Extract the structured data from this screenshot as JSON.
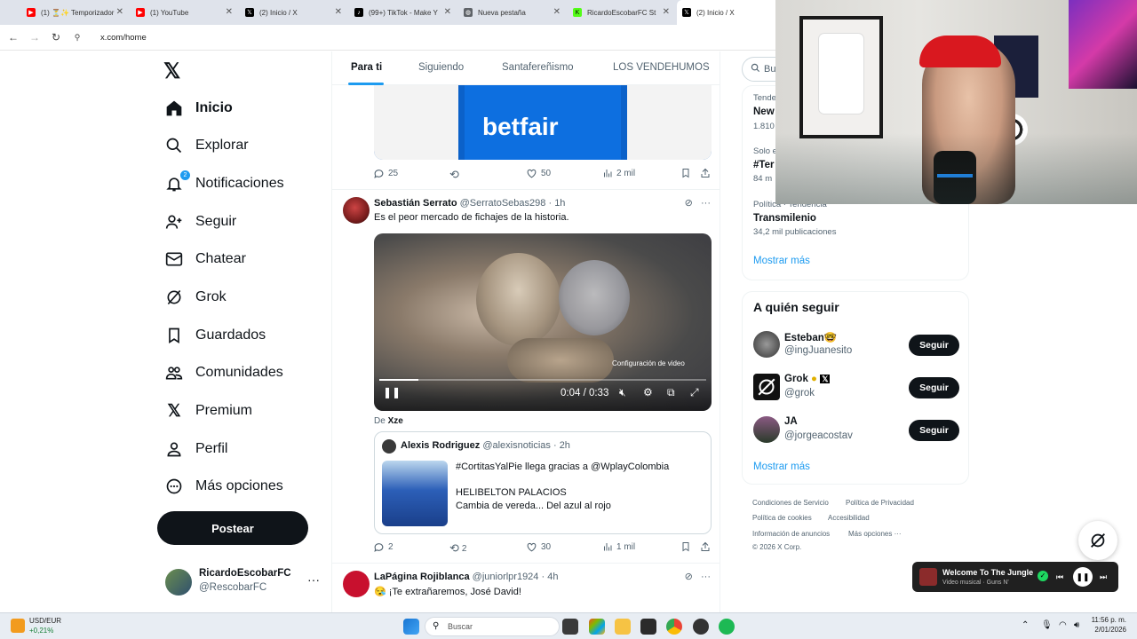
{
  "browser": {
    "tabs": [
      {
        "label": "(1) ⏳✨ Temporizador",
        "color": "#ff0000"
      },
      {
        "label": "(1) YouTube",
        "color": "#ff0000"
      },
      {
        "label": "(2) Inicio / X",
        "color": "#000000"
      },
      {
        "label": "(99+) TikTok - Make Y",
        "color": "#000000"
      },
      {
        "label": "Nueva pestaña",
        "color": "#5f6368"
      },
      {
        "label": "RicardoEscobarFC St",
        "color": "#53fc18"
      },
      {
        "label": "(2) Inicio / X",
        "color": "#000000"
      }
    ],
    "url": "x.com/home"
  },
  "nav": {
    "items": [
      {
        "label": "Inicio",
        "icon": "home-icon"
      },
      {
        "label": "Explorar",
        "icon": "search-icon"
      },
      {
        "label": "Notificaciones",
        "icon": "bell-icon",
        "badge": "2"
      },
      {
        "label": "Seguir",
        "icon": "person-add-icon"
      },
      {
        "label": "Chatear",
        "icon": "mail-icon"
      },
      {
        "label": "Grok",
        "icon": "grok-icon"
      },
      {
        "label": "Guardados",
        "icon": "bookmark-icon"
      },
      {
        "label": "Comunidades",
        "icon": "communities-icon"
      },
      {
        "label": "Premium",
        "icon": "x-logo-icon"
      },
      {
        "label": "Perfil",
        "icon": "person-icon"
      },
      {
        "label": "Más opciones",
        "icon": "more-circle-icon"
      }
    ],
    "post_label": "Postear",
    "profile": {
      "name": "RicardoEscobarFC",
      "handle": "@RescobarFC"
    }
  },
  "feed": {
    "tabs": [
      "Para ti",
      "Siguiendo",
      "Santafereñismo",
      "LOS VENDEHUMOS"
    ],
    "top_post": {
      "brand": "betfair",
      "actions": {
        "replies": "25",
        "reposts": "",
        "likes": "50",
        "views": "2 mil"
      }
    },
    "post1": {
      "name": "Sebastián Serrato",
      "handle": "@SerratoSebas298",
      "time": "· 1h",
      "text": "Es el peor mercado de fichajes de la historia.",
      "video": {
        "settings_tip": "Configuración de video",
        "time": "0:04 / 0:33",
        "progress": 0.12
      },
      "source_prefix": "De",
      "source": "Xze",
      "quote": {
        "name": "Alexis Rodriguez",
        "handle": "@alexisnoticias",
        "time": "· 2h",
        "line1": "#CortitasYalPie llega gracias a @WplayColombia",
        "line2": "HELIBELTON PALACIOS",
        "line3": "Cambia de vereda... Del azul al rojo"
      },
      "actions": {
        "replies": "2",
        "reposts": "2",
        "likes": "30",
        "views": "1 mil"
      }
    },
    "post2": {
      "name": "LaPágina Rojiblanca",
      "handle": "@juniorlpr1924",
      "time": "· 4h",
      "text": "😪 ¡Te extrañaremos, José David!"
    }
  },
  "sidebar": {
    "search_placeholder": "Bu",
    "trends": [
      {
        "meta": "Tende",
        "title": "New",
        "count": "1.810"
      },
      {
        "meta": "Solo e",
        "title": "#Ter",
        "count": "84 m"
      },
      {
        "meta": "Política · Tendencia",
        "title": "Transmilenio",
        "count": "34,2 mil publicaciones"
      }
    ],
    "show_more": "Mostrar más",
    "who_to_follow_title": "A quién seguir",
    "follow": [
      {
        "name": "Esteban🤓",
        "handle": "@ingJuanesito",
        "button": "Seguir"
      },
      {
        "name": "Grok",
        "handle": "@grok",
        "button": "Seguir"
      },
      {
        "name": "JA",
        "handle": "@jorgeacostav",
        "button": "Seguir"
      }
    ],
    "show_more_2": "Mostrar más",
    "footer": {
      "l1": "Condiciones de Servicio",
      "l2": "Política de Privacidad",
      "l3": "Política de cookies",
      "l4": "Accesibilidad",
      "l5": "Información de anuncios",
      "l6": "Más opciones ···",
      "copy": "© 2026 X Corp."
    }
  },
  "music": {
    "title": "Welcome To The Jungle",
    "subtitle": "Video musical · Guns N'"
  },
  "taskbar": {
    "ticker": "USD/EUR",
    "change": "+0,21%",
    "search": "Buscar",
    "time": "11:56 p. m.",
    "date": "2/01/2026"
  }
}
